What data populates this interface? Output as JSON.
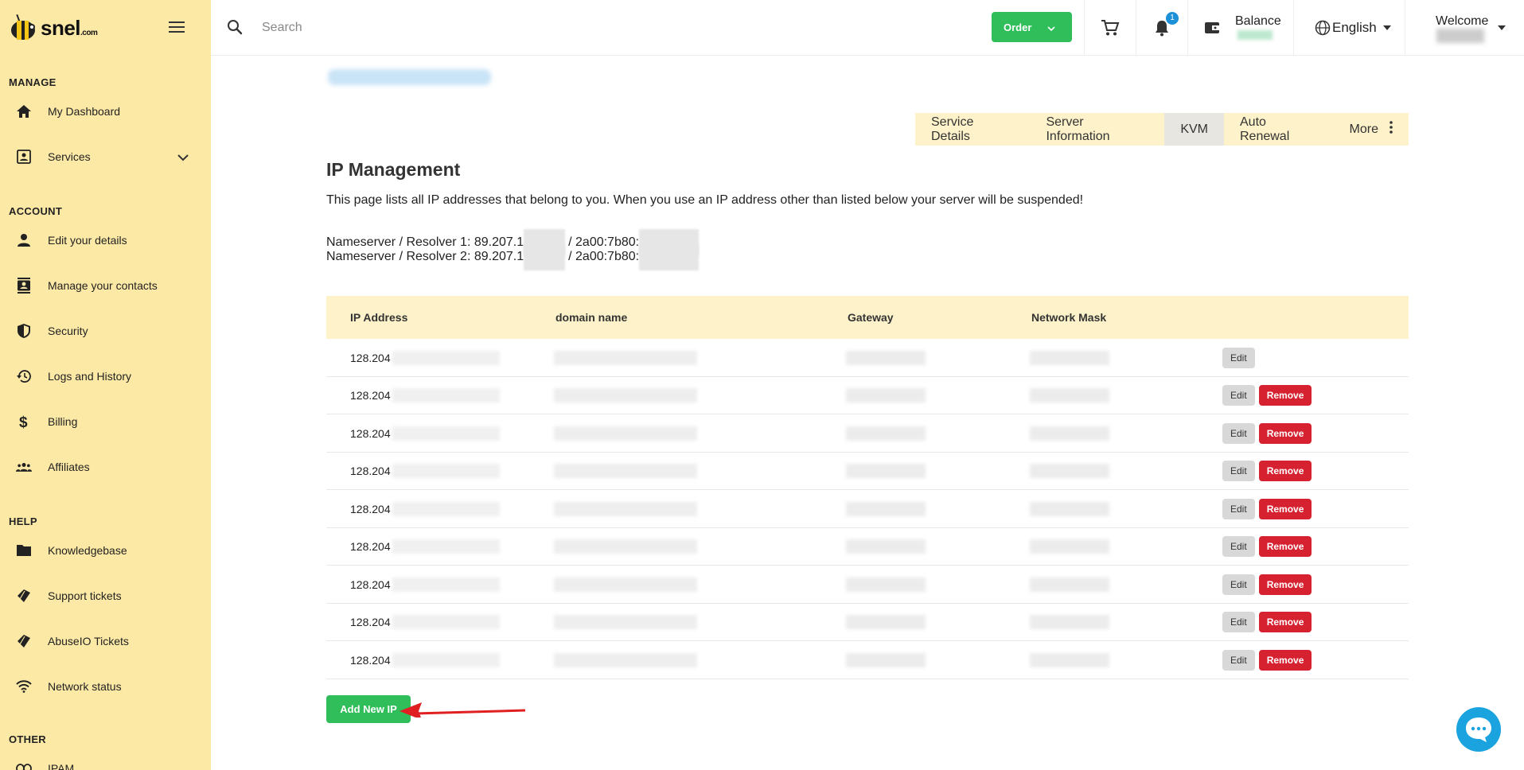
{
  "brand": {
    "name": "snel",
    "suffix": ".com"
  },
  "sidebar": {
    "sections": [
      {
        "title": "MANAGE",
        "items": [
          {
            "label": "My Dashboard",
            "icon": "home-icon"
          },
          {
            "label": "Services",
            "icon": "services-icon",
            "expandable": true
          }
        ]
      },
      {
        "title": "ACCOUNT",
        "items": [
          {
            "label": "Edit your details",
            "icon": "user-icon"
          },
          {
            "label": "Manage your contacts",
            "icon": "contacts-icon"
          },
          {
            "label": "Security",
            "icon": "shield-icon"
          },
          {
            "label": "Logs and History",
            "icon": "history-icon"
          },
          {
            "label": "Billing",
            "icon": "dollar-icon"
          },
          {
            "label": "Affiliates",
            "icon": "affiliates-icon"
          }
        ]
      },
      {
        "title": "HELP",
        "items": [
          {
            "label": "Knowledgebase",
            "icon": "folder-icon"
          },
          {
            "label": "Support tickets",
            "icon": "tickets-icon"
          },
          {
            "label": "AbuseIO Tickets",
            "icon": "tickets-icon"
          },
          {
            "label": "Network status",
            "icon": "wifi-icon"
          }
        ]
      },
      {
        "title": "OTHER",
        "items": [
          {
            "label": "IPAM",
            "icon": "link-icon"
          }
        ]
      }
    ]
  },
  "header": {
    "search_placeholder": "Search",
    "order_label": "Order",
    "notification_count": "1",
    "balance_label": "Balance",
    "language_label": "English",
    "welcome_label": "Welcome"
  },
  "tabs": [
    {
      "label": "Service Details",
      "active": false
    },
    {
      "label": "Server Information",
      "active": false
    },
    {
      "label": "KVM",
      "active": true
    },
    {
      "label": "Auto Renewal",
      "active": false
    },
    {
      "label": "More",
      "active": false
    }
  ],
  "page": {
    "title": "IP Management",
    "description": "This page lists all IP addresses that belong to you. When you use an IP address other than listed below your server will be suspended!",
    "ns1_prefix": "Nameserver / Resolver 1: 89.207.1",
    "ns1_ipv6": "/ 2a00:7b80:",
    "ns2_prefix": "Nameserver / Resolver 2: 89.207.1",
    "ns2_ipv6": "/ 2a00:7b80:"
  },
  "table": {
    "headers": [
      "IP Address",
      "domain name",
      "Gateway",
      "Network Mask"
    ],
    "ip_prefix": "128.204",
    "edit_label": "Edit",
    "remove_label": "Remove",
    "rows": [
      {
        "removable": false
      },
      {
        "removable": true
      },
      {
        "removable": true
      },
      {
        "removable": true
      },
      {
        "removable": true
      },
      {
        "removable": true
      },
      {
        "removable": true
      },
      {
        "removable": true
      },
      {
        "removable": true
      }
    ]
  },
  "add_button_label": "Add New IP",
  "colors": {
    "sidebar_bg": "#fde9a6",
    "accent_green": "#2fbe5a",
    "remove_red": "#d62230",
    "tab_bg": "#fdf2c9"
  }
}
